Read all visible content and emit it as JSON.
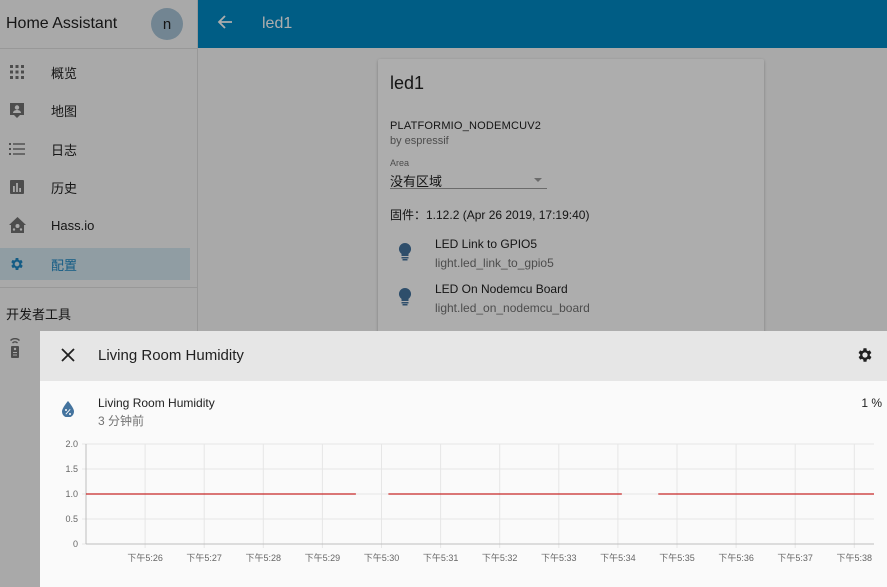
{
  "sidebar": {
    "title": "Home Assistant",
    "avatar_initial": "n",
    "items": [
      {
        "label": "概览",
        "icon": "apps-icon",
        "active": false
      },
      {
        "label": "地图",
        "icon": "account-box-icon",
        "active": false
      },
      {
        "label": "日志",
        "icon": "list-icon",
        "active": false
      },
      {
        "label": "历史",
        "icon": "chart-bar-icon",
        "active": false
      },
      {
        "label": "Hass.io",
        "icon": "home-assistant-icon",
        "active": false
      },
      {
        "label": "配置",
        "icon": "settings-icon",
        "active": true
      }
    ],
    "dev_tools_title": "开发者工具",
    "dev_tools_icon": "remote-icon"
  },
  "appbar": {
    "title": "led1",
    "back_icon": "arrow-left-icon"
  },
  "device_card": {
    "name": "led1",
    "model": "PLATFORMIO_NODEMCUV2",
    "manufacturer": "by espressif",
    "area_label": "Area",
    "area_value": "没有区域",
    "firmware": "固件：1.12.2 (Apr 26 2019, 17:19:40)",
    "entities": [
      {
        "name": "LED Link to GPIO5",
        "entity_id": "light.led_link_to_gpio5",
        "icon": "lightbulb-icon"
      },
      {
        "name": "LED On Nodemcu Board",
        "entity_id": "light.led_on_nodemcu_board",
        "icon": "lightbulb-icon"
      }
    ]
  },
  "dialog": {
    "title": "Living Room Humidity",
    "close_icon": "close-icon",
    "settings_icon": "settings-icon",
    "entity": {
      "name": "Living Room Humidity",
      "last_changed": "3 分钟前",
      "state": "1 %",
      "icon": "water-percent-icon"
    }
  },
  "colors": {
    "primary": "#0089c5",
    "sidebar_active_bg": "#d4e7f1",
    "sidebar_active_fg": "#1e88c4",
    "line": "#c62828",
    "entity_icon": "#44739e"
  },
  "chart_data": {
    "type": "line",
    "x_ticks": [
      "下午5:26",
      "下午5:27",
      "下午5:28",
      "下午5:29",
      "下午5:30",
      "下午5:31",
      "下午5:32",
      "下午5:33",
      "下午5:34",
      "下午5:35",
      "下午5:36",
      "下午5:37",
      "下午5:38"
    ],
    "y_ticks": [
      "2.0",
      "1.5",
      "1.0",
      "0.5",
      "0"
    ],
    "ylim": [
      0,
      2
    ],
    "xlim": [
      "17:25:00",
      "17:38:20"
    ],
    "grid": true,
    "series": [
      {
        "segments": [
          {
            "x": [
              "17:25:00",
              "17:29:34"
            ],
            "y": [
              1,
              1
            ]
          },
          {
            "x": [
              "17:30:07",
              "17:34:04"
            ],
            "y": [
              1,
              1
            ]
          },
          {
            "x": [
              "17:34:41",
              "17:38:20"
            ],
            "y": [
              1,
              1
            ]
          }
        ]
      }
    ]
  }
}
